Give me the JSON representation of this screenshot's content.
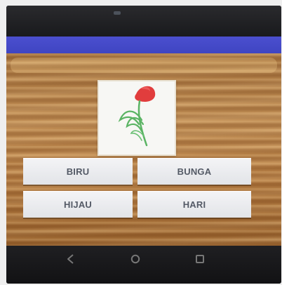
{
  "quiz": {
    "options": [
      {
        "label": "BIRU"
      },
      {
        "label": "BUNGA"
      },
      {
        "label": "HIJAU"
      },
      {
        "label": "HARI"
      }
    ]
  },
  "navigation": {
    "back": "back-icon",
    "home": "home-icon",
    "recent": "recent-apps-icon"
  },
  "colors": {
    "app_bar": "#4048c8",
    "button_text": "#545a66",
    "flower_red": "#e23a3a",
    "stem_green": "#5bb464"
  }
}
